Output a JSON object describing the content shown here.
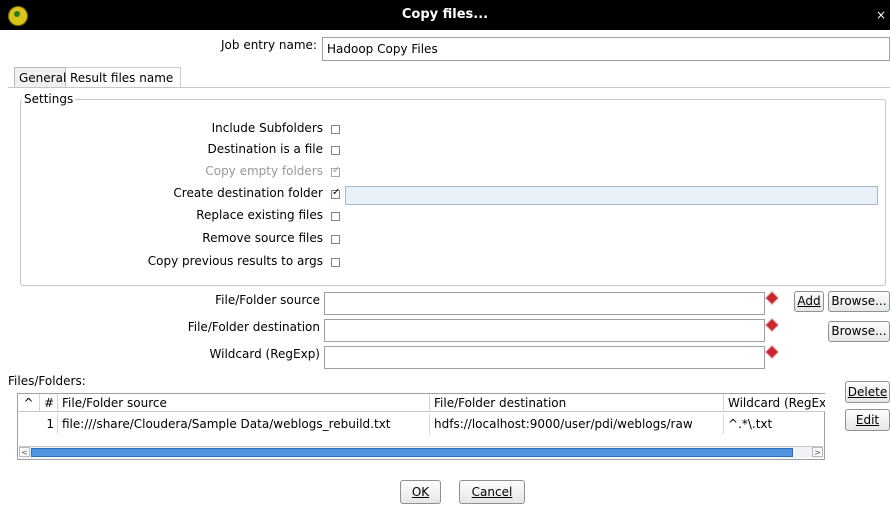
{
  "window": {
    "title": "Copy files...",
    "close_glyph": "×"
  },
  "job_entry": {
    "label": "Job entry name:",
    "value": "Hadoop Copy Files"
  },
  "tabs": [
    {
      "label": "General"
    },
    {
      "label": "Result files name"
    }
  ],
  "settings": {
    "group_label": "Settings",
    "options": [
      {
        "label": "Include Subfolders",
        "checked": false,
        "enabled": true
      },
      {
        "label": "Destination is a file",
        "checked": false,
        "enabled": true
      },
      {
        "label": "Copy empty folders",
        "checked": true,
        "enabled": false
      },
      {
        "label": "Create destination folder",
        "checked": true,
        "enabled": true
      },
      {
        "label": "Replace existing files",
        "checked": false,
        "enabled": true
      },
      {
        "label": "Remove source files",
        "checked": false,
        "enabled": true
      },
      {
        "label": "Copy previous results to args",
        "checked": false,
        "enabled": true
      }
    ]
  },
  "source": {
    "label": "File/Folder source",
    "value": ""
  },
  "destination": {
    "label": "File/Folder destination",
    "value": ""
  },
  "wildcard": {
    "label": "Wildcard (RegExp)",
    "value": ""
  },
  "buttons": {
    "add": "Add",
    "browse": "Browse...",
    "delete": "Delete",
    "edit": "Edit",
    "ok": "OK",
    "cancel": "Cancel"
  },
  "files_folders": {
    "label": "Files/Folders:",
    "columns": [
      "^",
      "#",
      "File/Folder source",
      "File/Folder destination",
      "Wildcard (RegExp)"
    ],
    "rows": [
      {
        "num": "1",
        "source": "file:///share/Cloudera/Sample Data/weblogs_rebuild.txt",
        "destination": "hdfs://localhost:9000/user/pdi/weblogs/raw",
        "wildcard": "^.*\\.txt"
      }
    ]
  },
  "colors": {
    "required_marker": "#c8282d",
    "scroll_thumb": "#4f95e0"
  },
  "icons": [
    "app-icon",
    "close-icon",
    "required-marker-icon",
    "scroll-left-icon",
    "scroll-right-icon"
  ]
}
